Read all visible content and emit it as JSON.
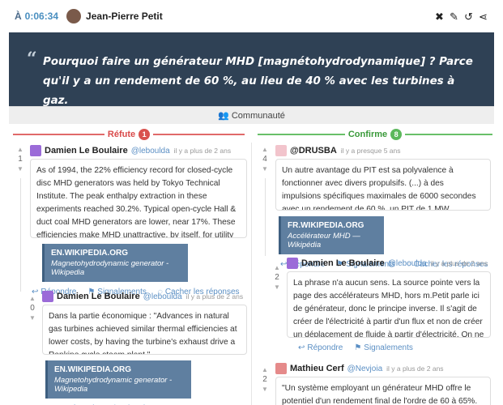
{
  "header": {
    "time_prefix": "À",
    "time": "0:06:34",
    "author": "Jean-Pierre Petit",
    "icons": [
      "close-icon",
      "edit-icon",
      "history-icon",
      "share-icon"
    ]
  },
  "statement": {
    "text": "Pourquoi faire un générateur MHD [magnétohydrodynamique] ? Parce qu'il y a un rendement de 60 %, au lieu de 40 % avec les turbines à gaz."
  },
  "community_label": "Communauté",
  "refute": {
    "label": "Réfute",
    "count": "1"
  },
  "confirm": {
    "label": "Confirme",
    "count": "8"
  },
  "actions": {
    "reply": "Répondre",
    "reports": "Signalements",
    "hide": "Cacher les réponses"
  },
  "arguments": [
    {
      "author": "Damien Le Boulaire",
      "handle": "@leboulda",
      "when": "il y a plus de 2 ans",
      "score": "1",
      "text": "As of 1994, the 22% efficiency record for closed-cycle disc MHD generators was held by Tokyo Technical Institute. The peak enthalpy extraction in these experiments reached 30.2%. Typical open-cycle Hall & duct coal MHD generators are lower, near 17%. These efficiencies make MHD unattractive, by itself, for utility power generation, since conventional Rankine cycle power plants easily reach 40%.",
      "source_domain": "EN.WIKIPEDIA.ORG",
      "source_desc": "Magnetohydrodynamic generator - Wikipedia"
    },
    {
      "author": "Damien Le Boulaire",
      "handle": "@leboulda",
      "when": "il y a plus de 2 ans",
      "score": "0",
      "text": "Dans la partie économique : \"Advances in natural gas turbines achieved similar thermal efficiencies at lower costs, by having the turbine's exhaust drive a Rankine cycle steam plant.\"",
      "source_domain": "EN.WIKIPEDIA.ORG",
      "source_desc": "Magnetohydrodynamic generator - Wikipedia"
    },
    {
      "author": "@DRUSBA",
      "handle": "-",
      "when": "il y a presque 5 ans",
      "score": "4",
      "text": "Un autre avantage du PIT est sa polyvalence à fonctionner avec divers propulsifs. (...) à des impulsions spécifiques maximales de 6000 secondes avec un rendement de 60 %, un PIT de 1 MW fonctionnerait en 200 Hz.",
      "source_domain": "FR.WIKIPEDIA.ORG",
      "source_desc": "Accélérateur MHD — Wikipédia"
    },
    {
      "author": "Damien Le Boulaire",
      "handle": "@leboulda",
      "when": "il y a plus de 2 ans",
      "score": "2",
      "text": "La phrase n'a aucun sens. La source pointe vers la page des accélérateurs MHD, hors m.Petit parle ici de générateur, donc le principe inverse. Il s'agit de créer de l'électricité à partir d'un flux et non de créer un déplacement de fluide à partir d'électricité. On ne peut pas appliquer les même rendements."
    },
    {
      "author": "Mathieu Cerf",
      "handle": "@Nevjoia",
      "when": "il y a plus de 2 ans",
      "score": "2",
      "text": "\"Un système employant un générateur MHD offre le potentiel d'un rendement final de l'ordre de 60 à 65%. C'est beaucoup mieux que les 35 à 40% de rendement atteints dans les"
    }
  ],
  "colors": {
    "statement_bg": "#2f4155",
    "refute": "#d9534f",
    "confirm": "#5cb85c",
    "link": "#5b8fc4",
    "source_bg": "#5f7fa0"
  }
}
